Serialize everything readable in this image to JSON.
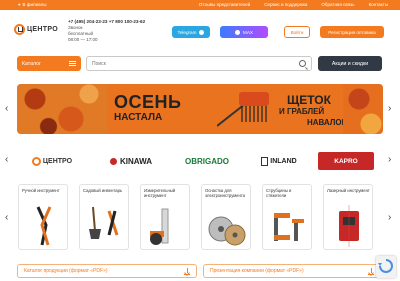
{
  "topbar": {
    "location": "В филиалы",
    "links": [
      "Отзывы представителей",
      "Сервис и поддержка",
      "Обратная связь",
      "Контакты"
    ]
  },
  "header": {
    "logo_text": "ЦЕНТРО",
    "phones": "+7 (495) 204-23-23  +7 800 100-23-62",
    "line2": "Звонок",
    "line3": "бесплатный",
    "hours": "08:00 — 17:00",
    "telegram_label": "Telegram",
    "max_label": "MAX",
    "login_label": "Войти",
    "register_label": "Регистрация оптовика"
  },
  "search": {
    "catalog_label": "Каталог",
    "placeholder": "Поиск",
    "promo_label": "Акции и скидки"
  },
  "banner": {
    "title1": "ОСЕНЬ",
    "title2": "НАСТАЛА",
    "right1": "ЩЕТОК",
    "right2": "И ГРАБЛЕЙ",
    "right3": "НАВАЛОМ"
  },
  "brands": [
    "ЦЕНТРО",
    "KINAWA",
    "OBRIGADO",
    "INLAND",
    "KAPRO"
  ],
  "categories": [
    {
      "label": "Ручной инструмент"
    },
    {
      "label": "Садовый инвентарь"
    },
    {
      "label": "Измерительный инструмент"
    },
    {
      "label": "Оснастка для электроинструмента"
    },
    {
      "label": "Струбцины и стяжители"
    },
    {
      "label": "Лазерный инструмент"
    }
  ],
  "downloads": {
    "catalog": "Каталог продукции (формат «PDF»)",
    "presentation": "Презентация компании (формат «PDF»)"
  },
  "colors": {
    "accent": "#f47a20",
    "dark": "#313a44",
    "telegram": "#2aa6e0"
  }
}
